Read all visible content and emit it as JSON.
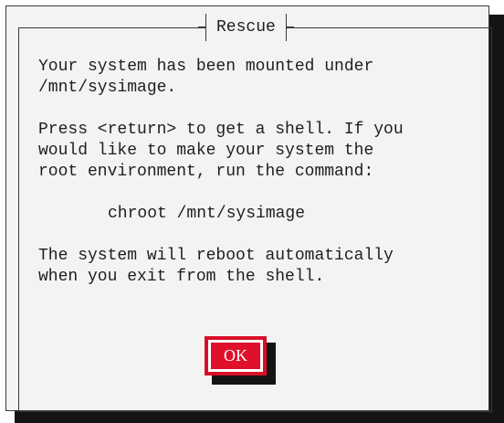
{
  "dialog": {
    "title": "Rescue",
    "lines": [
      "Your system has been mounted under",
      "/mnt/sysimage.",
      "Press <return> to get a shell. If you",
      "would like to make your system the",
      "root environment, run the command:",
      "chroot /mnt/sysimage",
      "The system will reboot automatically",
      "when you exit from the shell."
    ],
    "ok_label": "OK"
  },
  "colors": {
    "dialog_bg": "#f3f3f3",
    "shadow": "#141414",
    "border": "#3a3a3a",
    "text": "#1e1e1e",
    "button_accent": "#e0102b",
    "button_text": "#ffffff"
  }
}
